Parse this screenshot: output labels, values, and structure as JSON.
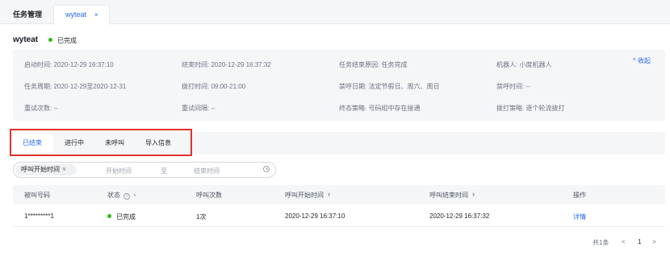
{
  "tabs": [
    {
      "label": "任务管理"
    },
    {
      "label": "wyteat",
      "close": "×"
    }
  ],
  "header": {
    "title": "wyteat",
    "status": "已完成",
    "status_color": "#30bf13"
  },
  "info": {
    "start_time": "启动时间: 2020-12-29 16:37:10",
    "end_time": "结束时间: 2020-12-29 16:37:32",
    "end_reason": "任务结束原因: 任务完成",
    "robot": "机器人: 小度机器人",
    "period": "任务周期: 2020-12-29至2020-12-31",
    "dial_time": "拨打时间: 09:00-21:00",
    "block_date": "禁呼日期: 法定节假日、周六、周日",
    "block_time": "禁呼时间: --",
    "retry_count": "重试次数: --",
    "retry_interval": "重试间隔: --",
    "final_policy": "终态策略: 号码组中存在接通",
    "dial_policy": "拨打策略: 逐个轮流拨打",
    "collapse": "收起",
    "collapse_icon": "chevron-up-icon"
  },
  "filter_tabs": [
    {
      "label": "已结束"
    },
    {
      "label": "进行中"
    },
    {
      "label": "未呼叫"
    },
    {
      "label": "导入信息"
    }
  ],
  "date_filter": {
    "type": "呼叫开始时间",
    "start_placeholder": "开始时间",
    "separator": "至",
    "end_placeholder": "结束时间"
  },
  "table": {
    "columns": [
      "被叫号码",
      "状态",
      "呼叫次数",
      "呼叫开始时间",
      "呼叫结束时间",
      "操作"
    ],
    "rows": [
      {
        "number": "1*********1",
        "status": "已完成",
        "count": "1次",
        "start": "2020-12-29 16:37:10",
        "end": "2020-12-29 16:37:32",
        "action": "详情"
      }
    ]
  },
  "pagination": {
    "total": "共1条",
    "prev": "<",
    "page": "1",
    "next": ">"
  },
  "colors": {
    "accent": "#2468f2",
    "highlight_box": "#e0322c"
  }
}
